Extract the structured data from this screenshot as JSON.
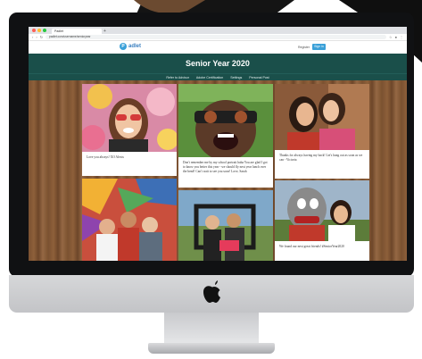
{
  "browser": {
    "tab_title": "Padlet",
    "url": "padlet.com/username/senioryear"
  },
  "app": {
    "logo_letter": "P",
    "logo_text": "adlet",
    "register_label": "Register",
    "signin_label": "Sign in"
  },
  "board": {
    "title": "Senior Year 2020",
    "toolbar": [
      "Refer to Advisor",
      "Adobe Certification",
      "Settings",
      "Personal Post"
    ]
  },
  "posts": [
    {
      "caption": "Love you always! XO Alexis"
    },
    {
      "caption": "Don't remember me by my school portrait haha You are glad I got to know you better this year - we should fly next year lunch over the bend! Can't wait to see you soon! Love, Sarah"
    },
    {
      "caption": "Thanks for always having my back! Let's hang out as soon as we can - Victoria"
    },
    {
      "caption": ""
    },
    {
      "caption": ""
    },
    {
      "caption": "We found our next great friends! #SeniorYear2020"
    }
  ],
  "colors": {
    "board_header": "#1a4f4a",
    "brand_blue": "#3aa0d8"
  }
}
